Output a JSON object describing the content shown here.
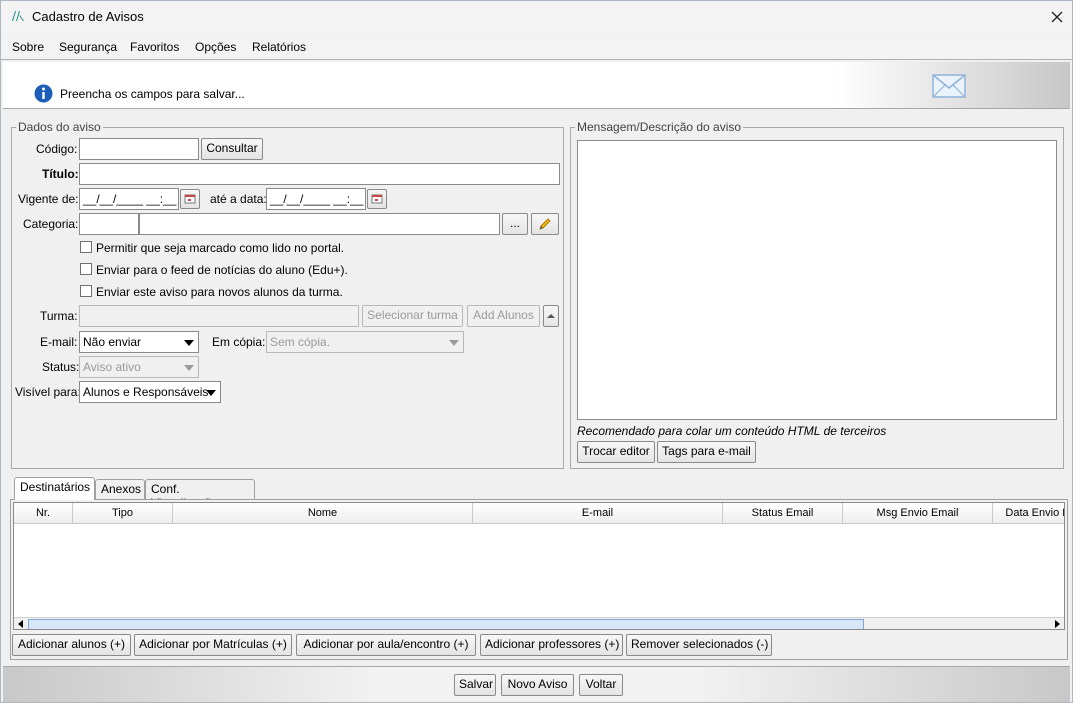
{
  "window": {
    "title": "Cadastro de Avisos"
  },
  "menu": [
    {
      "label": "Sobre"
    },
    {
      "label": "Segurança"
    },
    {
      "label": "Favoritos"
    },
    {
      "label": "Opções"
    },
    {
      "label": "Relatórios"
    }
  ],
  "banner": {
    "message": "Preencha os campos para salvar..."
  },
  "dados": {
    "group_title": "Dados do aviso",
    "codigo_label": "Código:",
    "codigo_value": "",
    "consultar_label": "Consultar",
    "titulo_label": "Título:",
    "titulo_value": "",
    "vigente_label": "Vigente de:",
    "vigente_value": "__/__/____ __:__",
    "ate_label": "até a data:",
    "ate_value": "__/__/____ __:__",
    "categoria_label": "Categoria:",
    "categoria_code": "",
    "categoria_name": "",
    "categoria_browse_label": "...",
    "checkboxes": [
      {
        "label": "Permitir que seja marcado como lido no portal.",
        "checked": false
      },
      {
        "label": "Enviar para o feed de notícias do aluno (Edu+).",
        "checked": false
      },
      {
        "label": "Enviar este aviso para novos alunos da turma.",
        "checked": false
      }
    ],
    "turma_label": "Turma:",
    "turma_value": "",
    "selecionar_turma_label": "Selecionar turma",
    "add_alunos_label": "Add Alunos",
    "email_label": "E-mail:",
    "email_value": "Não enviar",
    "em_copia_label": "Em cópia:",
    "em_copia_value": "Sem cópia.",
    "status_label": "Status:",
    "status_value": "Aviso ativo",
    "visivel_label": "Visível para:",
    "visivel_value": "Alunos e Responsáveis"
  },
  "mensagem": {
    "group_title": "Mensagem/Descrição do aviso",
    "content": "",
    "hint": "Recomendado para colar um conteúdo HTML de terceiros",
    "trocar_editor_label": "Trocar editor",
    "tags_label": "Tags para e-mail"
  },
  "tabs": [
    {
      "label": "Destinatários",
      "active": true
    },
    {
      "label": "Anexos",
      "active": false
    },
    {
      "label": "Conf. Visualização",
      "active": false
    }
  ],
  "table": {
    "columns": [
      "Nr.",
      "Tipo",
      "Nome",
      "E-mail",
      "Status Email",
      "Msg Envio Email",
      "Data Envio E"
    ],
    "rows": []
  },
  "recipient_buttons": [
    "Adicionar alunos (+)",
    "Adicionar por Matrículas (+)",
    "Adicionar por aula/encontro (+)",
    "Adicionar professores (+)",
    "Remover selecionados (-)"
  ],
  "footer": {
    "salvar_label": "Salvar",
    "novo_aviso_label": "Novo Aviso",
    "voltar_label": "Voltar"
  },
  "colors": {
    "logo": "#1a8a7a",
    "info_icon": "#1d5fb8",
    "mail_icon": "#8fb3d9",
    "scroll_thumb": "#d7e7f7"
  }
}
